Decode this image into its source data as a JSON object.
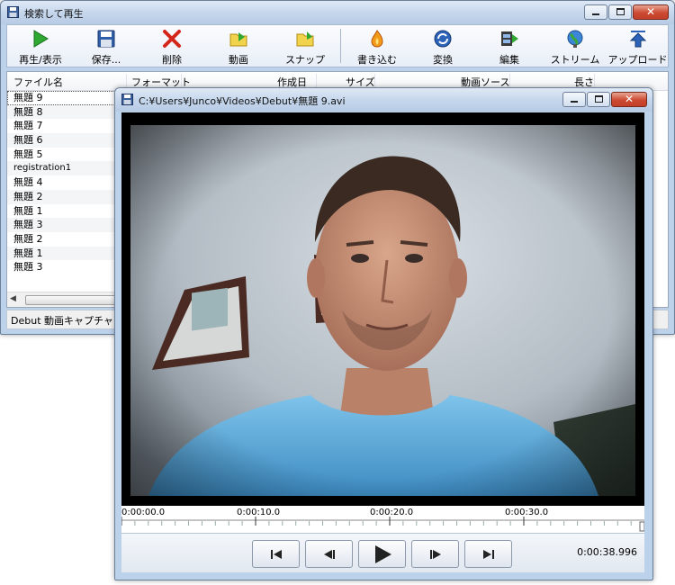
{
  "main_window": {
    "title": "検索して再生",
    "toolbar": [
      {
        "label": "再生/表示",
        "icon": "play-icon"
      },
      {
        "label": "保存...",
        "icon": "save-icon"
      },
      {
        "label": "削除",
        "icon": "delete-icon"
      },
      {
        "label": "動画",
        "icon": "video-folder-icon"
      },
      {
        "label": "スナップ",
        "icon": "snapshot-folder-icon"
      },
      {
        "label": "書き込む",
        "icon": "burn-icon"
      },
      {
        "label": "変換",
        "icon": "convert-icon"
      },
      {
        "label": "編集",
        "icon": "edit-film-icon"
      },
      {
        "label": "ストリーム",
        "icon": "stream-globe-icon"
      },
      {
        "label": "アップロード",
        "icon": "upload-icon"
      }
    ],
    "columns": [
      "ファイル名",
      "フォーマット",
      "作成日",
      "サイズ",
      "動画ソース",
      "長さ"
    ],
    "files": [
      "無題 9",
      "無題 8",
      "無題 7",
      "無題 6",
      "無題 5",
      "registration1",
      "無題 4",
      "無題 2",
      "無題 1",
      "無題 3",
      "無題 2",
      "無題 1",
      "無題 3"
    ],
    "status": "Debut 動画キャプチャ"
  },
  "player_window": {
    "title": "C:¥Users¥Junco¥Videos¥Debut¥無題 9.avi",
    "timeline_labels": [
      "0:00:00.0",
      "0:00:10.0",
      "0:00:20.0",
      "0:00:30.0"
    ],
    "controls": [
      "skip-start-button",
      "step-back-button",
      "play-button",
      "step-forward-button",
      "skip-end-button"
    ],
    "timecode": "0:00:38.996"
  },
  "colors": {
    "titlebar": "#c6d7ec",
    "close_button": "#cc4a31",
    "play_green": "#2fa832"
  }
}
